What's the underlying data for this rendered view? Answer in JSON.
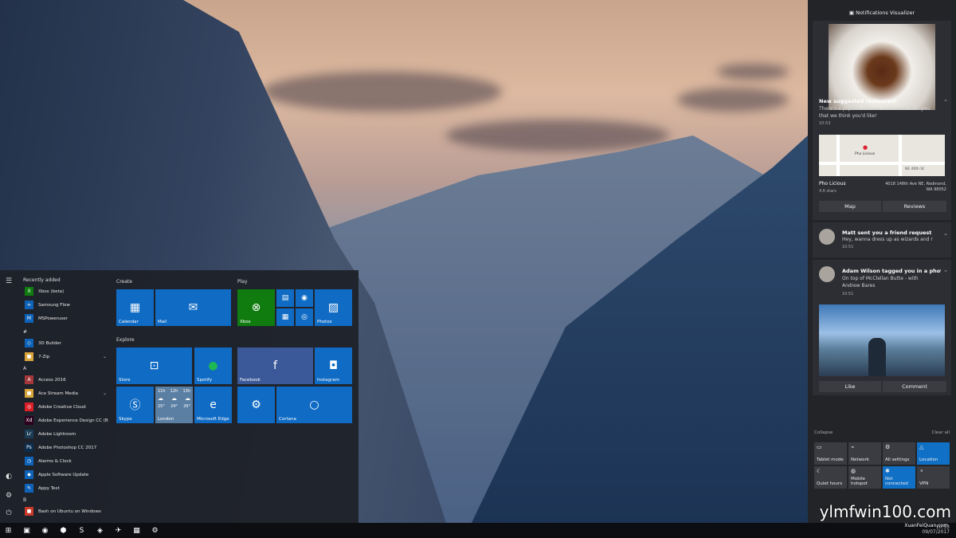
{
  "start": {
    "rail_icons": [
      "☰",
      "◐",
      "⚙",
      "⏻"
    ],
    "recently_added": "Recently added",
    "recent_apps": [
      {
        "label": "Xbox (beta)",
        "icon": "X",
        "color": "#107c10"
      },
      {
        "label": "Samsung Flow",
        "icon": "∞",
        "color": "#0e63b8"
      },
      {
        "label": "MSPoweruser",
        "icon": "M",
        "color": "#0e63b8"
      }
    ],
    "hash_header": "#",
    "hash_apps": [
      {
        "label": "3D Builder",
        "icon": "◇",
        "color": "#0e63b8"
      },
      {
        "label": "7-Zip",
        "icon": "■",
        "color": "#d8a53a",
        "chev": "⌄"
      }
    ],
    "a_header": "A",
    "a_apps": [
      {
        "label": "Access 2016",
        "icon": "A",
        "color": "#a4373a"
      },
      {
        "label": "Ace Stream Media",
        "icon": "■",
        "color": "#d8a53a",
        "chev": "⌄"
      },
      {
        "label": "Adobe Creative Cloud",
        "icon": "◎",
        "color": "#da1f26"
      },
      {
        "label": "Adobe Experience Design CC (Beta)",
        "icon": "Xd",
        "color": "#2d001e"
      },
      {
        "label": "Adobe Lightroom",
        "icon": "Lr",
        "color": "#1c3d55"
      },
      {
        "label": "Adobe Photoshop CC 2017",
        "icon": "Ps",
        "color": "#0b2d4e"
      },
      {
        "label": "Alarms & Clock",
        "icon": "◷",
        "color": "#0e63b8"
      },
      {
        "label": "Apple Software Update",
        "icon": "◆",
        "color": "#0e63b8"
      },
      {
        "label": "Appy Text",
        "icon": "✎",
        "color": "#0e63b8"
      }
    ],
    "b_header": "B",
    "b_apps": [
      {
        "label": "Bash on Ubuntu on Windows",
        "icon": "■",
        "color": "#c83a2a"
      }
    ],
    "groups": {
      "create": "Create",
      "play": "Play",
      "explore": "Explore"
    },
    "tiles": {
      "calendar": "Calendar",
      "mail": "Mail",
      "xbox": "Xbox",
      "photos": "Photos",
      "store": "Store",
      "spotify": "Spotify",
      "facebook": "Facebook",
      "instagram": "Instagram",
      "skype": "Skype",
      "london": "London",
      "edge": "Microsoft Edge",
      "cortana": "Cortana"
    },
    "weather": {
      "days": [
        "11h",
        "12h",
        "13h"
      ],
      "temps": [
        "25°",
        "24°",
        "26°"
      ]
    }
  },
  "action_center": {
    "title": "Notifications Visualizer",
    "n1": {
      "title": "New suggested restaurant",
      "text": "There's a popular chinese restaurant near you that we think you'd like!",
      "time": "10:53"
    },
    "place": {
      "name": "Pho Licious",
      "rating": "4.6 stars",
      "address": "4018 148th Ave NE, Redmond, WA 98052",
      "map_label": "Pho Licious",
      "street": "NE 40th St"
    },
    "buttons": {
      "map": "Map",
      "reviews": "Reviews",
      "like": "Like",
      "comment": "Comment"
    },
    "n2": {
      "title": "Matt sent you a friend request",
      "text": "Hey, wanna dress up as wizards and r",
      "time": "10:51"
    },
    "n3": {
      "title": "Adam Wilson tagged you in a photo",
      "text": "On top of McClellan Butte - with Andrew Bares",
      "time": "10:51"
    },
    "collapse": "Collapse",
    "clear_all": "Clear all",
    "quick": [
      {
        "label": "Tablet mode",
        "icon": "▭",
        "on": false
      },
      {
        "label": "Network",
        "icon": "⌁",
        "on": false
      },
      {
        "label": "All settings",
        "icon": "⚙",
        "on": false
      },
      {
        "label": "Location",
        "icon": "△",
        "on": true
      },
      {
        "label": "Quiet hours",
        "icon": "☾",
        "on": false
      },
      {
        "label": "Mobile hotspot",
        "icon": "◍",
        "on": false
      },
      {
        "label": "Not connected",
        "icon": "✱",
        "on": true
      },
      {
        "label": "VPN",
        "icon": "⚬",
        "on": false
      }
    ]
  },
  "taskbar": {
    "icons": [
      "⊞",
      "▣",
      "◉",
      "⬢",
      "S",
      "◈",
      "✈",
      "▦",
      "⚙"
    ],
    "time": "10:53",
    "date": "09/07/2017"
  },
  "watermark": {
    "main": "ylmfwin100.com",
    "sub": "XuanFeiQuan.com"
  }
}
